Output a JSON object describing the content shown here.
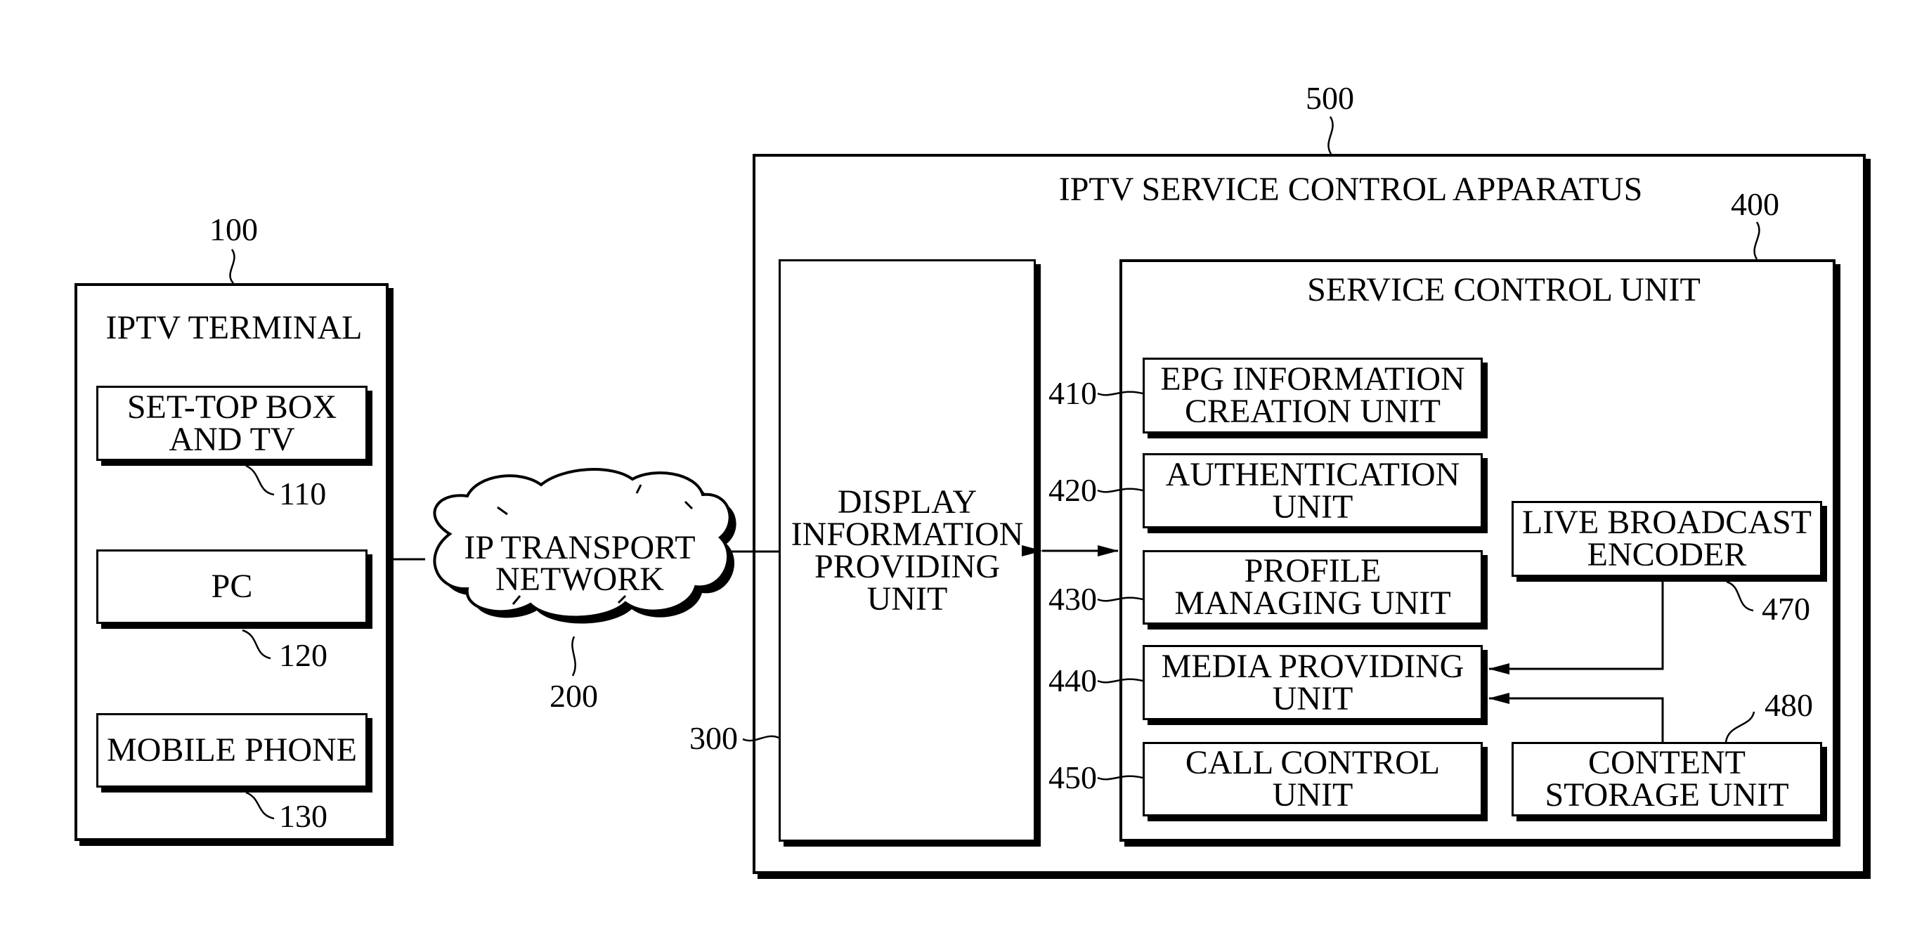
{
  "diagram": {
    "apparatus": {
      "ref": "500",
      "title": "IPTV SERVICE CONTROL APPARATUS"
    },
    "terminal": {
      "ref": "100",
      "title": "IPTV TERMINAL",
      "devices": [
        {
          "ref": "110",
          "label": "SET-TOP BOX\nAND TV"
        },
        {
          "ref": "120",
          "label": "PC"
        },
        {
          "ref": "130",
          "label": "MOBILE PHONE"
        }
      ]
    },
    "network": {
      "ref": "200",
      "label": "IP TRANSPORT\nNETWORK"
    },
    "display_unit": {
      "ref": "300",
      "label": "DISPLAY\nINFORMATION\nPROVIDING\nUNIT"
    },
    "service_control": {
      "ref": "400",
      "title": "SERVICE CONTROL UNIT",
      "units": [
        {
          "ref": "410",
          "label": "EPG INFORMATION\nCREATION UNIT"
        },
        {
          "ref": "420",
          "label": "AUTHENTICATION\nUNIT"
        },
        {
          "ref": "430",
          "label": "PROFILE\nMANAGING  UNIT"
        },
        {
          "ref": "440",
          "label": "MEDIA PROVIDING\nUNIT"
        },
        {
          "ref": "450",
          "label": "CALL CONTROL\nUNIT"
        }
      ],
      "encoder": {
        "ref": "470",
        "label": "LIVE BROADCAST\nENCODER"
      },
      "storage": {
        "ref": "480",
        "label": "CONTENT\nSTORAGE UNIT"
      }
    },
    "connections": [
      {
        "from": "IPTV TERMINAL",
        "to": "IP TRANSPORT NETWORK",
        "type": "line"
      },
      {
        "from": "IP TRANSPORT NETWORK",
        "to": "DISPLAY INFORMATION PROVIDING UNIT",
        "type": "line"
      },
      {
        "from": "DISPLAY INFORMATION PROVIDING UNIT",
        "to": "SERVICE CONTROL UNIT",
        "type": "bidirectional-arrow"
      },
      {
        "from": "LIVE BROADCAST ENCODER",
        "to": "MEDIA PROVIDING UNIT",
        "type": "arrow"
      },
      {
        "from": "CONTENT STORAGE UNIT",
        "to": "MEDIA PROVIDING UNIT",
        "type": "arrow"
      }
    ]
  }
}
